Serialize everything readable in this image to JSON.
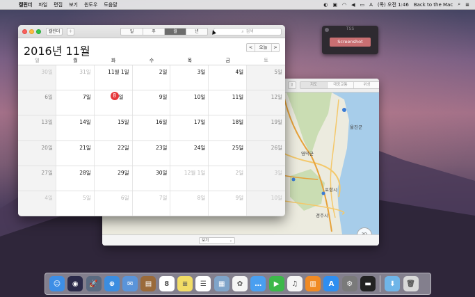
{
  "menubar": {
    "app": "캘린더",
    "items": [
      "파일",
      "편집",
      "보기",
      "윈도우",
      "도움말"
    ],
    "clock": "(목) 오전 1:46",
    "user": "Back to the Mac"
  },
  "screenshot_tool": {
    "title": "TSS",
    "button": "Screenshot"
  },
  "maps": {
    "segments": [
      "지도",
      "대중교통",
      "위성"
    ],
    "view_select": "보기",
    "labels": [
      "포항시",
      "경주시",
      "울진군",
      "영덕군"
    ],
    "compass": "3D",
    "colors": {
      "water": "#a7cdea",
      "land": "#ecebdf",
      "green": "#c7dcae",
      "road": "#f4c86a",
      "highway": "#e7a23a"
    }
  },
  "calendar": {
    "toolbar_calendars": "캘린더",
    "add_label": "+",
    "views": [
      "일",
      "주",
      "월",
      "년"
    ],
    "active_view": "월",
    "search_placeholder": "검색",
    "month_title": "2016년 11월",
    "today_button": "오늘",
    "prev": "<",
    "next": ">",
    "weekdays": [
      "일",
      "월",
      "화",
      "수",
      "목",
      "금",
      "토"
    ],
    "weeks": [
      [
        "30일",
        "31일",
        "11월 1일",
        "2일",
        "3일",
        "4일",
        "5일"
      ],
      [
        "6일",
        "7일",
        "8",
        "9일",
        "10일",
        "11일",
        "12일"
      ],
      [
        "13일",
        "14일",
        "15일",
        "16일",
        "17일",
        "18일",
        "19일"
      ],
      [
        "20일",
        "21일",
        "22일",
        "23일",
        "24일",
        "25일",
        "26일"
      ],
      [
        "27일",
        "28일",
        "29일",
        "30일",
        "12월 1일",
        "2일",
        "3일"
      ],
      [
        "4일",
        "5일",
        "6일",
        "7일",
        "8일",
        "9일",
        "10일"
      ]
    ],
    "today_suffix": "일",
    "today_color": "#e5383b"
  },
  "dock": {
    "apps": [
      {
        "name": "finder-icon",
        "color": "#3d8ee6",
        "glyph": "☺"
      },
      {
        "name": "siri-icon",
        "color": "#2b2a4a",
        "glyph": "◉"
      },
      {
        "name": "launchpad-icon",
        "color": "#5a6a80",
        "glyph": "🚀"
      },
      {
        "name": "safari-icon",
        "color": "#3b8de0",
        "glyph": "⊕"
      },
      {
        "name": "mail-icon",
        "color": "#5a94d9",
        "glyph": "✉"
      },
      {
        "name": "notes-icon",
        "color": "#9a6a3a",
        "glyph": "▤"
      },
      {
        "name": "calendar-icon",
        "color": "#ffffff",
        "glyph": "8"
      },
      {
        "name": "stickies-icon",
        "color": "#f2dd66",
        "glyph": "≡"
      },
      {
        "name": "reminders-icon",
        "color": "#ffffff",
        "glyph": "☰"
      },
      {
        "name": "preview-icon",
        "color": "#7fa4c9",
        "glyph": "▦"
      },
      {
        "name": "photos-icon",
        "color": "#f5f5f5",
        "glyph": "✿"
      },
      {
        "name": "messages-icon",
        "color": "#4a9ff0",
        "glyph": "…"
      },
      {
        "name": "facetime-icon",
        "color": "#3cb84a",
        "glyph": "▶"
      },
      {
        "name": "itunes-icon",
        "color": "#f5f5f5",
        "glyph": "♫"
      },
      {
        "name": "ibooks-icon",
        "color": "#f08a24",
        "glyph": "▥"
      },
      {
        "name": "appstore-icon",
        "color": "#2e8ef0",
        "glyph": "A"
      },
      {
        "name": "system-preferences-icon",
        "color": "#7a7a7a",
        "glyph": "⚙"
      },
      {
        "name": "activity-monitor-icon",
        "color": "#222222",
        "glyph": "▬"
      }
    ],
    "trailing": [
      {
        "name": "downloads-folder-icon",
        "color": "#6fb5e8",
        "glyph": "⬇"
      },
      {
        "name": "trash-icon",
        "color": "#d9d9d9",
        "glyph": "🗑"
      }
    ]
  }
}
